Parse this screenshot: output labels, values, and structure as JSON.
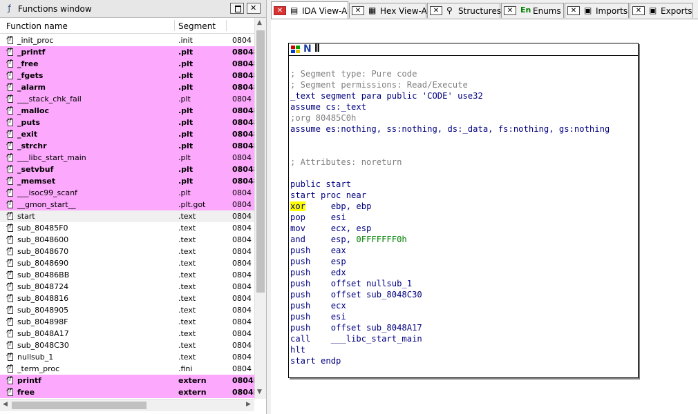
{
  "functions_window": {
    "title": "Functions window",
    "columns": {
      "name": "Function name",
      "segment": "Segment"
    },
    "rows": [
      {
        "name": "_init_proc",
        "segment": ".init",
        "address": "0804",
        "style": "plain"
      },
      {
        "name": "_printf",
        "segment": ".plt",
        "address": "08048",
        "style": "pink-bold"
      },
      {
        "name": "_free",
        "segment": ".plt",
        "address": "08048",
        "style": "pink-bold"
      },
      {
        "name": "_fgets",
        "segment": ".plt",
        "address": "08048",
        "style": "pink-bold"
      },
      {
        "name": "_alarm",
        "segment": ".plt",
        "address": "08048",
        "style": "pink-bold"
      },
      {
        "name": "___stack_chk_fail",
        "segment": ".plt",
        "address": "0804",
        "style": "pink"
      },
      {
        "name": "_malloc",
        "segment": ".plt",
        "address": "08048",
        "style": "pink-bold"
      },
      {
        "name": "_puts",
        "segment": ".plt",
        "address": "08048",
        "style": "pink-bold"
      },
      {
        "name": "_exit",
        "segment": ".plt",
        "address": "08048",
        "style": "pink-bold"
      },
      {
        "name": "_strchr",
        "segment": ".plt",
        "address": "08048",
        "style": "pink-bold"
      },
      {
        "name": "___libc_start_main",
        "segment": ".plt",
        "address": "0804",
        "style": "pink"
      },
      {
        "name": "_setvbuf",
        "segment": ".plt",
        "address": "08048",
        "style": "pink-bold"
      },
      {
        "name": "_memset",
        "segment": ".plt",
        "address": "08048",
        "style": "pink-bold"
      },
      {
        "name": "___isoc99_scanf",
        "segment": ".plt",
        "address": "0804",
        "style": "pink"
      },
      {
        "name": "__gmon_start__",
        "segment": ".plt.got",
        "address": "0804",
        "style": "pink"
      },
      {
        "name": "start",
        "segment": ".text",
        "address": "0804",
        "style": "selected"
      },
      {
        "name": "sub_80485F0",
        "segment": ".text",
        "address": "0804",
        "style": "plain"
      },
      {
        "name": "sub_8048600",
        "segment": ".text",
        "address": "0804",
        "style": "plain"
      },
      {
        "name": "sub_8048670",
        "segment": ".text",
        "address": "0804",
        "style": "plain"
      },
      {
        "name": "sub_8048690",
        "segment": ".text",
        "address": "0804",
        "style": "plain"
      },
      {
        "name": "sub_80486BB",
        "segment": ".text",
        "address": "0804",
        "style": "plain"
      },
      {
        "name": "sub_8048724",
        "segment": ".text",
        "address": "0804",
        "style": "plain"
      },
      {
        "name": "sub_8048816",
        "segment": ".text",
        "address": "0804",
        "style": "plain"
      },
      {
        "name": "sub_8048905",
        "segment": ".text",
        "address": "0804",
        "style": "plain"
      },
      {
        "name": "sub_804898F",
        "segment": ".text",
        "address": "0804",
        "style": "plain"
      },
      {
        "name": "sub_8048A17",
        "segment": ".text",
        "address": "0804",
        "style": "plain"
      },
      {
        "name": "sub_8048C30",
        "segment": ".text",
        "address": "0804",
        "style": "plain"
      },
      {
        "name": "nullsub_1",
        "segment": ".text",
        "address": "0804",
        "style": "plain"
      },
      {
        "name": "_term_proc",
        "segment": ".fini",
        "address": "0804",
        "style": "plain"
      },
      {
        "name": "printf",
        "segment": "extern",
        "address": "0804E",
        "style": "pink-bold"
      },
      {
        "name": "free",
        "segment": "extern",
        "address": "0804E",
        "style": "pink-bold"
      }
    ]
  },
  "tabs": [
    {
      "label": "IDA View-A",
      "icon": "document-icon",
      "active": true
    },
    {
      "label": "Hex View-A",
      "icon": "hex-icon",
      "active": false
    },
    {
      "label": "Structures",
      "icon": "structures-icon",
      "active": false
    },
    {
      "label": "Enums",
      "icon": "enums-icon",
      "icon_text": "En",
      "active": false
    },
    {
      "label": "Imports",
      "icon": "imports-icon",
      "active": false
    },
    {
      "label": "Exports",
      "icon": "exports-icon",
      "active": false
    }
  ],
  "code_lines": [
    [
      {
        "t": "; Segment type: Pure code",
        "c": "comment"
      }
    ],
    [
      {
        "t": "; Segment permissions: Read/Execute",
        "c": "comment"
      }
    ],
    [
      {
        "t": "_text segment para public 'CODE' use32",
        "c": "blue"
      }
    ],
    [
      {
        "t": "assume cs:_text",
        "c": "blue"
      }
    ],
    [
      {
        "t": ";org 80485C0h",
        "c": "comment"
      }
    ],
    [
      {
        "t": "assume es:nothing, ss:nothing, ds:_data, fs:nothing, gs:nothing",
        "c": "blue"
      }
    ],
    [],
    [],
    [
      {
        "t": "; Attributes: noreturn",
        "c": "comment"
      }
    ],
    [],
    [
      {
        "t": "public start",
        "c": "blue"
      }
    ],
    [
      {
        "t": "start proc near",
        "c": "blue"
      }
    ],
    [
      {
        "t": "xor",
        "c": "blue",
        "hl": true
      },
      {
        "t": "     ebp, ebp",
        "c": "blue"
      }
    ],
    [
      {
        "t": "pop     esi",
        "c": "blue"
      }
    ],
    [
      {
        "t": "mov     ecx, esp",
        "c": "blue"
      }
    ],
    [
      {
        "t": "and     esp, ",
        "c": "blue"
      },
      {
        "t": "0FFFFFFF0h",
        "c": "green"
      }
    ],
    [
      {
        "t": "push    eax",
        "c": "blue"
      }
    ],
    [
      {
        "t": "push    esp",
        "c": "blue"
      }
    ],
    [
      {
        "t": "push    edx",
        "c": "blue"
      }
    ],
    [
      {
        "t": "push    offset nullsub_1",
        "c": "blue"
      }
    ],
    [
      {
        "t": "push    offset sub_8048C30",
        "c": "blue"
      }
    ],
    [
      {
        "t": "push    ecx",
        "c": "blue"
      }
    ],
    [
      {
        "t": "push    esi",
        "c": "blue"
      }
    ],
    [
      {
        "t": "push    offset sub_8048A17",
        "c": "blue"
      }
    ],
    [
      {
        "t": "call    ___libc_start_main",
        "c": "blue"
      }
    ],
    [
      {
        "t": "hlt",
        "c": "blue"
      }
    ],
    [
      {
        "t": "start endp",
        "c": "blue"
      }
    ]
  ],
  "colors": {
    "pink_row": "#fca8fc",
    "highlight": "#ffff00",
    "code_blue": "#000080",
    "code_green": "#008000",
    "code_comment": "#808080"
  }
}
